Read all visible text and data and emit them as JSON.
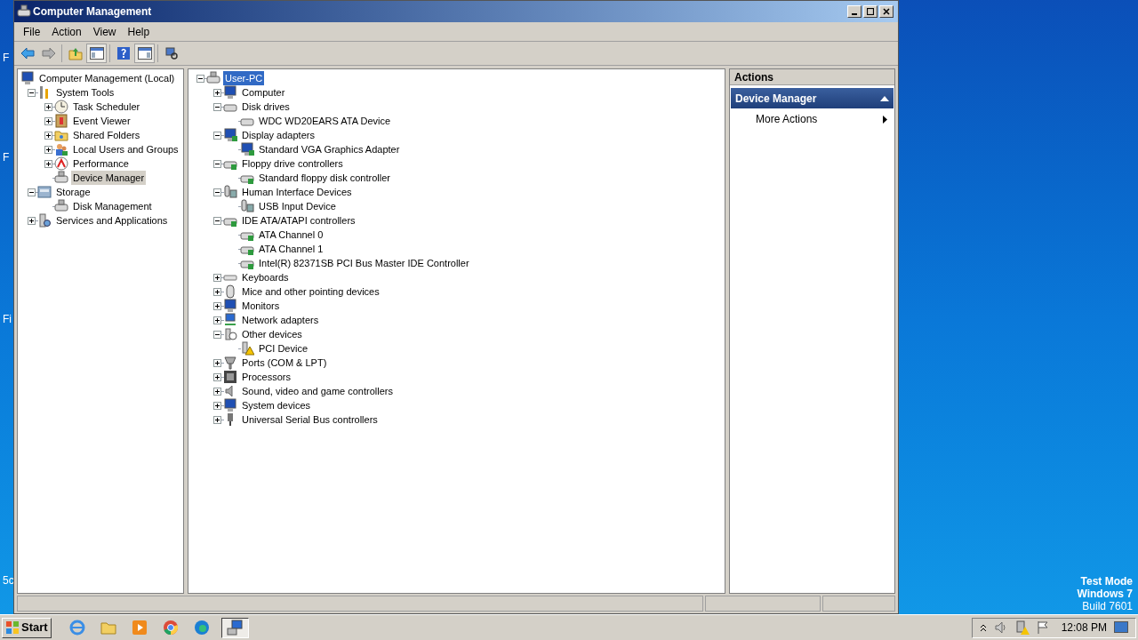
{
  "desktop": {
    "icon_labels": [
      "F",
      "F",
      "Fi",
      "5c"
    ],
    "watermark": [
      "Test Mode",
      "Windows 7",
      "Build 7601"
    ]
  },
  "window": {
    "title": "Computer Management"
  },
  "menu": [
    "File",
    "Action",
    "View",
    "Help"
  ],
  "console_tree": {
    "label": "Computer Management (Local)",
    "kind": "computer",
    "selected": false,
    "children": [
      {
        "label": "System Tools",
        "kind": "tools",
        "selected": false,
        "expanded": true,
        "children": [
          {
            "label": "Task Scheduler",
            "kind": "clock",
            "selected": false,
            "expanded": false
          },
          {
            "label": "Event Viewer",
            "kind": "log",
            "selected": false,
            "expanded": false
          },
          {
            "label": "Shared Folders",
            "kind": "folder",
            "selected": false,
            "expanded": false
          },
          {
            "label": "Local Users and Groups",
            "kind": "people",
            "selected": false,
            "expanded": false
          },
          {
            "label": "Performance",
            "kind": "gauge",
            "selected": false,
            "expanded": false
          },
          {
            "label": "Device Manager",
            "kind": "devmgr",
            "selected": true
          }
        ]
      },
      {
        "label": "Storage",
        "kind": "storage",
        "selected": false,
        "expanded": true,
        "children": [
          {
            "label": "Disk Management",
            "kind": "devmgr",
            "selected": false
          }
        ]
      },
      {
        "label": "Services and Applications",
        "kind": "services",
        "selected": false,
        "expanded": false
      }
    ]
  },
  "device_tree": {
    "label": "User-PC",
    "kind": "devmgr",
    "selected": true,
    "expanded": true,
    "children": [
      {
        "label": "Computer",
        "kind": "computer",
        "selected": false,
        "expanded": false
      },
      {
        "label": "Disk drives",
        "kind": "drive",
        "selected": false,
        "expanded": true,
        "children": [
          {
            "label": "WDC WD20EARS ATA Device",
            "kind": "drive",
            "selected": false
          }
        ]
      },
      {
        "label": "Display adapters",
        "kind": "display",
        "selected": false,
        "expanded": true,
        "children": [
          {
            "label": "Standard VGA Graphics Adapter",
            "kind": "display",
            "selected": false
          }
        ]
      },
      {
        "label": "Floppy drive controllers",
        "kind": "floppy",
        "selected": false,
        "expanded": true,
        "children": [
          {
            "label": "Standard floppy disk controller",
            "kind": "floppy",
            "selected": false
          }
        ]
      },
      {
        "label": "Human Interface Devices",
        "kind": "hid",
        "selected": false,
        "expanded": true,
        "children": [
          {
            "label": "USB Input Device",
            "kind": "hid",
            "selected": false
          }
        ]
      },
      {
        "label": "IDE ATA/ATAPI controllers",
        "kind": "ide",
        "selected": false,
        "expanded": true,
        "children": [
          {
            "label": "ATA Channel 0",
            "kind": "ide",
            "selected": false
          },
          {
            "label": "ATA Channel 1",
            "kind": "ide",
            "selected": false
          },
          {
            "label": "Intel(R) 82371SB PCI Bus Master IDE Controller",
            "kind": "ide",
            "selected": false
          }
        ]
      },
      {
        "label": "Keyboards",
        "kind": "keyboard",
        "selected": false,
        "expanded": false
      },
      {
        "label": "Mice and other pointing devices",
        "kind": "mouse",
        "selected": false,
        "expanded": false
      },
      {
        "label": "Monitors",
        "kind": "monitor",
        "selected": false,
        "expanded": false
      },
      {
        "label": "Network adapters",
        "kind": "network",
        "selected": false,
        "expanded": false
      },
      {
        "label": "Other devices",
        "kind": "unknown",
        "selected": false,
        "expanded": true,
        "children": [
          {
            "label": "PCI Device",
            "kind": "warning",
            "selected": false
          }
        ]
      },
      {
        "label": "Ports (COM & LPT)",
        "kind": "port",
        "selected": false,
        "expanded": false
      },
      {
        "label": "Processors",
        "kind": "chip",
        "selected": false,
        "expanded": false
      },
      {
        "label": "Sound, video and game controllers",
        "kind": "speaker",
        "selected": false,
        "expanded": false
      },
      {
        "label": "System devices",
        "kind": "computer",
        "selected": false,
        "expanded": false
      },
      {
        "label": "Universal Serial Bus controllers",
        "kind": "usb",
        "selected": false,
        "expanded": false
      }
    ]
  },
  "actions": {
    "header": "Actions",
    "section": "Device Manager",
    "expanded": true,
    "items": [
      {
        "label": "More Actions"
      }
    ]
  },
  "taskbar": {
    "start": "Start",
    "apps": [
      {
        "kind": "ie",
        "selected": false
      },
      {
        "kind": "explorer",
        "selected": false
      },
      {
        "kind": "media",
        "selected": false
      },
      {
        "kind": "chrome",
        "selected": false
      },
      {
        "kind": "edge",
        "selected": false
      },
      {
        "kind": "compmgmt",
        "selected": true
      }
    ],
    "clock": "12:08 PM"
  }
}
